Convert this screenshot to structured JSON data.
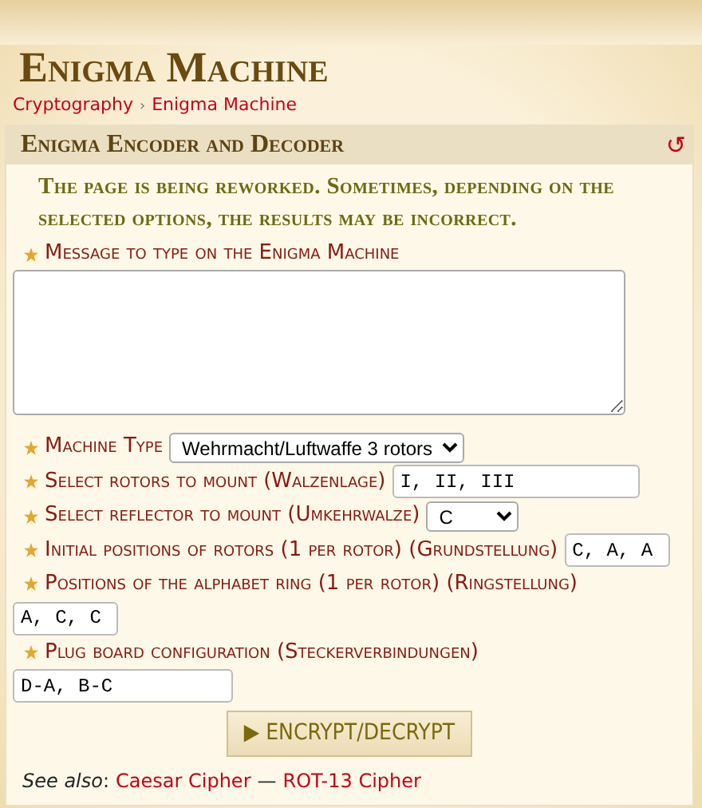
{
  "page": {
    "title": "Enigma Machine"
  },
  "breadcrumb": {
    "items": [
      {
        "label": "Cryptography"
      },
      {
        "label": "Enigma Machine"
      }
    ],
    "separator": "›"
  },
  "panel": {
    "title": "Enigma Encoder and Decoder",
    "reset_icon": "↺",
    "notice": "The page is being reworked. Sometimes, depending on the selected options, the results may be incorrect.",
    "fields": [
      {
        "kind": "textarea",
        "label": "Message to type on the Enigma Machine"
      },
      {
        "kind": "select",
        "label": "Machine Type",
        "value": "Wehrmacht/Luftwaffe 3 rotors"
      },
      {
        "kind": "input",
        "label": "Select rotors to mount (Walzenlage)",
        "value": "I, II, III"
      },
      {
        "kind": "select",
        "label": "Select reflector to mount (Umkehrwalze)",
        "value": "C"
      },
      {
        "kind": "input",
        "label": "Initial positions of rotors (1 per rotor) (Grundstellung)",
        "value": "C, A, A"
      },
      {
        "kind": "input",
        "label": "Positions of the alphabet ring (1 per rotor) (Ringstellung)",
        "value": "A, C, C"
      },
      {
        "kind": "input",
        "label": "Plug board configuration (Steckerverbindungen)",
        "value": "D-A, B-C"
      }
    ],
    "button": {
      "icon": "▶",
      "label": "ENCRYPT/DECRYPT"
    },
    "see_also": {
      "label": "*See also*:",
      "links": [
        {
          "label": "Caesar Cipher"
        },
        {
          "label": "ROT-13 Cipher"
        }
      ],
      "separator": "—"
    }
  }
}
